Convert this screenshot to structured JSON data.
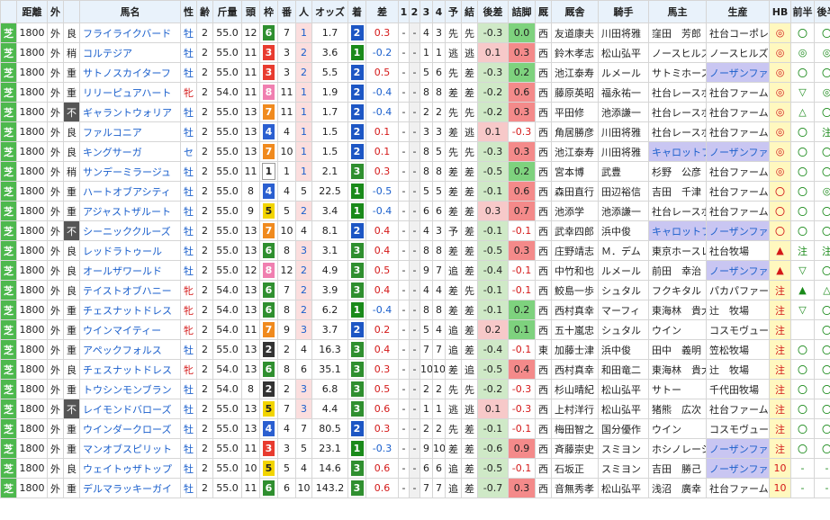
{
  "headers": [
    "",
    "距離",
    "外",
    "",
    "馬名",
    "性",
    "齢",
    "斤量",
    "頭",
    "枠",
    "番",
    "人",
    "オッズ",
    "着",
    "差",
    "1",
    "2",
    "3",
    "4",
    "予",
    "結",
    "後差",
    "詰脚",
    "厩",
    "厩舎",
    "騎手",
    "馬主",
    "生産",
    "HB",
    "前半",
    "後半"
  ],
  "colors": {
    "waku1": "#ffffff",
    "waku2": "#333333",
    "waku3": "#e83b2f",
    "waku4": "#2b5fd0",
    "waku5": "#f2d400",
    "waku6": "#2f8f2f",
    "waku7": "#f08a1e",
    "waku8": "#f07fb0",
    "rank1": "#1a8a1a",
    "rank2": "#1d56c4",
    "rank3": "#2f8f2f"
  },
  "rows": [
    {
      "s": "芝",
      "d": "1800",
      "g": "外",
      "c": "良",
      "name": "フライライクバード",
      "sex": "牡",
      "age": "2",
      "kin": "55.0",
      "n": "12",
      "w": "6",
      "b": "7",
      "pop": "1",
      "odds": "1.7",
      "rank": "2",
      "diff": "0.3",
      "p1": "-",
      "p2": "-",
      "p3": "4",
      "p4": "3",
      "y": "先",
      "r": "先",
      "ato": "-0.3",
      "tsu": "0.0",
      "st": "西",
      "trainer": "友道康夫",
      "jockey": "川田将雅",
      "owner": "窪田　芳郎",
      "breeder": "社台コーポレ",
      "hb": "◎",
      "zen": "〇",
      "kou": "〇"
    },
    {
      "s": "芝",
      "d": "1800",
      "g": "外",
      "c": "稍",
      "name": "コルテジア",
      "sex": "牡",
      "age": "2",
      "kin": "55.0",
      "n": "11",
      "w": "3",
      "b": "3",
      "pop": "2",
      "odds": "3.6",
      "rank": "1",
      "diff": "-0.2",
      "p1": "-",
      "p2": "-",
      "p3": "1",
      "p4": "1",
      "y": "逃",
      "r": "逃",
      "ato": "0.1",
      "tsu": "0.3",
      "st": "西",
      "trainer": "鈴木孝志",
      "jockey": "松山弘平",
      "owner": "ノースヒルズ",
      "breeder": "ノースヒルズ",
      "hb": "◎",
      "zen": "◎",
      "kou": "◎"
    },
    {
      "s": "芝",
      "d": "1800",
      "g": "外",
      "c": "重",
      "name": "サトノスカイターフ",
      "sex": "牡",
      "age": "2",
      "kin": "55.0",
      "n": "11",
      "w": "3",
      "b": "3",
      "pop": "2",
      "odds": "5.5",
      "rank": "2",
      "diff": "0.5",
      "p1": "-",
      "p2": "-",
      "p3": "5",
      "p4": "6",
      "y": "先",
      "r": "差",
      "ato": "-0.3",
      "tsu": "0.2",
      "st": "西",
      "trainer": "池江泰寿",
      "jockey": "ルメール",
      "owner": "サトミホース",
      "breeder": "ノーザンファ",
      "hb": "◎",
      "zen": "〇",
      "kou": "〇"
    },
    {
      "s": "芝",
      "d": "1800",
      "g": "外",
      "c": "重",
      "name": "リリーピュアハート",
      "sex": "牝",
      "age": "2",
      "kin": "54.0",
      "n": "11",
      "w": "8",
      "b": "11",
      "pop": "1",
      "odds": "1.9",
      "rank": "2",
      "diff": "-0.4",
      "p1": "-",
      "p2": "-",
      "p3": "8",
      "p4": "8",
      "y": "差",
      "r": "差",
      "ato": "-0.2",
      "tsu": "0.6",
      "st": "西",
      "trainer": "藤原英昭",
      "jockey": "福永祐一",
      "owner": "社台レースホ",
      "breeder": "社台ファーム",
      "hb": "◎",
      "zen": "▽",
      "kou": "◎"
    },
    {
      "s": "芝",
      "d": "1800",
      "g": "外",
      "c": "不",
      "name": "ギャラントウォリア",
      "sex": "牡",
      "age": "2",
      "kin": "55.0",
      "n": "13",
      "w": "7",
      "b": "11",
      "pop": "1",
      "odds": "1.7",
      "rank": "2",
      "diff": "-0.4",
      "p1": "-",
      "p2": "-",
      "p3": "2",
      "p4": "2",
      "y": "先",
      "r": "先",
      "ato": "-0.2",
      "tsu": "0.3",
      "st": "西",
      "trainer": "平田修",
      "jockey": "池添謙一",
      "owner": "社台レースホ",
      "breeder": "社台ファーム",
      "hb": "◎",
      "zen": "△",
      "kou": "〇"
    },
    {
      "s": "芝",
      "d": "1800",
      "g": "外",
      "c": "良",
      "name": "ファルコニア",
      "sex": "牡",
      "age": "2",
      "kin": "55.0",
      "n": "13",
      "w": "4",
      "b": "4",
      "pop": "1",
      "odds": "1.5",
      "rank": "2",
      "diff": "0.1",
      "p1": "-",
      "p2": "-",
      "p3": "3",
      "p4": "3",
      "y": "差",
      "r": "逃",
      "ato": "0.1",
      "tsu": "-0.3",
      "st": "西",
      "trainer": "角居勝彦",
      "jockey": "川田将雅",
      "owner": "社台レースホ",
      "breeder": "社台ファーム",
      "hb": "◎",
      "zen": "〇",
      "kou": "注"
    },
    {
      "s": "芝",
      "d": "1800",
      "g": "外",
      "c": "良",
      "name": "キングサーガ",
      "sex": "セ",
      "age": "2",
      "kin": "55.0",
      "n": "13",
      "w": "7",
      "b": "10",
      "pop": "1",
      "odds": "1.5",
      "rank": "2",
      "diff": "0.1",
      "p1": "-",
      "p2": "-",
      "p3": "8",
      "p4": "5",
      "y": "先",
      "r": "先",
      "ato": "-0.3",
      "tsu": "0.3",
      "st": "西",
      "trainer": "池江泰寿",
      "jockey": "川田将雅",
      "owner": "キャロットフ",
      "breeder": "ノーザンファ",
      "hb": "◎",
      "zen": "〇",
      "kou": "〇"
    },
    {
      "s": "芝",
      "d": "1800",
      "g": "外",
      "c": "稍",
      "name": "サンデーミラージュ",
      "sex": "牡",
      "age": "2",
      "kin": "55.0",
      "n": "11",
      "w": "1",
      "b": "1",
      "pop": "1",
      "odds": "2.1",
      "rank": "3",
      "diff": "0.3",
      "p1": "-",
      "p2": "-",
      "p3": "8",
      "p4": "8",
      "y": "差",
      "r": "差",
      "ato": "-0.5",
      "tsu": "0.2",
      "st": "西",
      "trainer": "宮本博",
      "jockey": "武豊",
      "owner": "杉野　公彦",
      "breeder": "社台ファーム",
      "hb": "◎",
      "zen": "〇",
      "kou": "〇"
    },
    {
      "s": "芝",
      "d": "1800",
      "g": "外",
      "c": "重",
      "name": "ハートオブアシティ",
      "sex": "牡",
      "age": "2",
      "kin": "55.0",
      "n": "8",
      "w": "4",
      "b": "4",
      "pop": "5",
      "odds": "22.5",
      "rank": "1",
      "diff": "-0.5",
      "p1": "-",
      "p2": "-",
      "p3": "5",
      "p4": "5",
      "y": "差",
      "r": "差",
      "ato": "-0.1",
      "tsu": "0.6",
      "st": "西",
      "trainer": "森田直行",
      "jockey": "田辺裕信",
      "owner": "吉田　千津",
      "breeder": "社台ファーム",
      "hb": "〇",
      "zen": "〇",
      "kou": "◎"
    },
    {
      "s": "芝",
      "d": "1800",
      "g": "外",
      "c": "重",
      "name": "アジャストザルート",
      "sex": "牡",
      "age": "2",
      "kin": "55.0",
      "n": "9",
      "w": "5",
      "b": "5",
      "pop": "2",
      "odds": "3.4",
      "rank": "1",
      "diff": "-0.4",
      "p1": "-",
      "p2": "-",
      "p3": "6",
      "p4": "6",
      "y": "差",
      "r": "差",
      "ato": "0.3",
      "tsu": "0.7",
      "st": "西",
      "trainer": "池添学",
      "jockey": "池添謙一",
      "owner": "社台レースホ",
      "breeder": "社台ファーム",
      "hb": "〇",
      "zen": "〇",
      "kou": "〇"
    },
    {
      "s": "芝",
      "d": "1800",
      "g": "外",
      "c": "不",
      "name": "シーニッククルーズ",
      "sex": "牡",
      "age": "2",
      "kin": "55.0",
      "n": "13",
      "w": "7",
      "b": "10",
      "pop": "4",
      "odds": "8.1",
      "rank": "2",
      "diff": "0.4",
      "p1": "-",
      "p2": "-",
      "p3": "4",
      "p4": "3",
      "y": "予",
      "r": "差",
      "ato": "-0.1",
      "tsu": "-0.1",
      "st": "西",
      "trainer": "武幸四郎",
      "jockey": "浜中俊",
      "owner": "キャロットフ",
      "breeder": "ノーザンファ",
      "hb": "〇",
      "zen": "〇",
      "kou": "〇"
    },
    {
      "s": "芝",
      "d": "1800",
      "g": "外",
      "c": "良",
      "name": "レッドラトゥール",
      "sex": "牡",
      "age": "2",
      "kin": "55.0",
      "n": "13",
      "w": "6",
      "b": "8",
      "pop": "3",
      "odds": "3.1",
      "rank": "3",
      "diff": "0.4",
      "p1": "-",
      "p2": "-",
      "p3": "8",
      "p4": "8",
      "y": "差",
      "r": "差",
      "ato": "-0.5",
      "tsu": "0.3",
      "st": "西",
      "trainer": "庄野靖志",
      "jockey": "Ｍ．デム",
      "owner": "東京ホースレ",
      "breeder": "社台牧場",
      "hb": "▲",
      "zen": "注",
      "kou": "注"
    },
    {
      "s": "芝",
      "d": "1800",
      "g": "外",
      "c": "良",
      "name": "オールザワールド",
      "sex": "牡",
      "age": "2",
      "kin": "55.0",
      "n": "12",
      "w": "8",
      "b": "12",
      "pop": "2",
      "odds": "4.9",
      "rank": "3",
      "diff": "0.5",
      "p1": "-",
      "p2": "-",
      "p3": "9",
      "p4": "7",
      "y": "追",
      "r": "差",
      "ato": "-0.4",
      "tsu": "-0.1",
      "st": "西",
      "trainer": "中竹和也",
      "jockey": "ルメール",
      "owner": "前田　幸治",
      "breeder": "ノーザンファ",
      "hb": "▲",
      "zen": "▽",
      "kou": "〇"
    },
    {
      "s": "芝",
      "d": "1800",
      "g": "外",
      "c": "良",
      "name": "テイストオブハニー",
      "sex": "牝",
      "age": "2",
      "kin": "54.0",
      "n": "13",
      "w": "6",
      "b": "7",
      "pop": "2",
      "odds": "3.9",
      "rank": "3",
      "diff": "0.4",
      "p1": "-",
      "p2": "-",
      "p3": "4",
      "p4": "4",
      "y": "差",
      "r": "先",
      "ato": "-0.1",
      "tsu": "-0.1",
      "st": "西",
      "trainer": "鮫島一歩",
      "jockey": "シュタル",
      "owner": "フクキタル",
      "breeder": "パカパファーム",
      "hb": "注",
      "zen": "▲",
      "kou": "△"
    },
    {
      "s": "芝",
      "d": "1800",
      "g": "外",
      "c": "重",
      "name": "チェスナットドレス",
      "sex": "牝",
      "age": "2",
      "kin": "54.0",
      "n": "13",
      "w": "6",
      "b": "8",
      "pop": "2",
      "odds": "6.2",
      "rank": "1",
      "diff": "-0.4",
      "p1": "-",
      "p2": "-",
      "p3": "8",
      "p4": "8",
      "y": "差",
      "r": "差",
      "ato": "-0.1",
      "tsu": "0.2",
      "st": "西",
      "trainer": "西村真幸",
      "jockey": "マーフィ",
      "owner": "東海林　貴大",
      "breeder": "辻　牧場",
      "hb": "注",
      "zen": "▽",
      "kou": "〇"
    },
    {
      "s": "芝",
      "d": "1800",
      "g": "外",
      "c": "重",
      "name": "ウインマイティー",
      "sex": "牝",
      "age": "2",
      "kin": "54.0",
      "n": "11",
      "w": "7",
      "b": "9",
      "pop": "3",
      "odds": "3.7",
      "rank": "2",
      "diff": "0.2",
      "p1": "-",
      "p2": "-",
      "p3": "5",
      "p4": "4",
      "y": "追",
      "r": "差",
      "ato": "0.2",
      "tsu": "0.1",
      "st": "西",
      "trainer": "五十嵐忠",
      "jockey": "シュタル",
      "owner": "ウイン",
      "breeder": "コスモヴュー",
      "hb": "注",
      "zen": "",
      "kou": "〇"
    },
    {
      "s": "芝",
      "d": "1800",
      "g": "外",
      "c": "重",
      "name": "アペックフォルス",
      "sex": "牡",
      "age": "2",
      "kin": "55.0",
      "n": "13",
      "w": "2",
      "b": "2",
      "pop": "4",
      "odds": "16.3",
      "rank": "3",
      "diff": "0.4",
      "p1": "-",
      "p2": "-",
      "p3": "7",
      "p4": "7",
      "y": "追",
      "r": "差",
      "ato": "-0.4",
      "tsu": "-0.1",
      "st": "東",
      "trainer": "加藤士津",
      "jockey": "浜中俊",
      "owner": "田中　義明",
      "breeder": "笠松牧場",
      "hb": "注",
      "zen": "〇",
      "kou": "〇"
    },
    {
      "s": "芝",
      "d": "1800",
      "g": "外",
      "c": "良",
      "name": "チェスナットドレス",
      "sex": "牝",
      "age": "2",
      "kin": "54.0",
      "n": "13",
      "w": "6",
      "b": "8",
      "pop": "6",
      "odds": "35.1",
      "rank": "3",
      "diff": "0.3",
      "p1": "-",
      "p2": "-",
      "p3": "10",
      "p4": "10",
      "y": "差",
      "r": "追",
      "ato": "-0.5",
      "tsu": "0.4",
      "st": "西",
      "trainer": "西村真幸",
      "jockey": "和田竜二",
      "owner": "東海林　貴大",
      "breeder": "辻　牧場",
      "hb": "注",
      "zen": "〇",
      "kou": "〇"
    },
    {
      "s": "芝",
      "d": "1800",
      "g": "外",
      "c": "重",
      "name": "トウシンモンブラン",
      "sex": "牡",
      "age": "2",
      "kin": "54.0",
      "n": "8",
      "w": "2",
      "b": "2",
      "pop": "3",
      "odds": "6.8",
      "rank": "3",
      "diff": "0.5",
      "p1": "-",
      "p2": "-",
      "p3": "2",
      "p4": "2",
      "y": "先",
      "r": "先",
      "ato": "-0.2",
      "tsu": "-0.3",
      "st": "西",
      "trainer": "杉山晴紀",
      "jockey": "松山弘平",
      "owner": "サトー",
      "breeder": "千代田牧場",
      "hb": "注",
      "zen": "〇",
      "kou": "〇"
    },
    {
      "s": "芝",
      "d": "1800",
      "g": "外",
      "c": "不",
      "name": "レイモンドバローズ",
      "sex": "牡",
      "age": "2",
      "kin": "55.0",
      "n": "13",
      "w": "5",
      "b": "7",
      "pop": "3",
      "odds": "4.4",
      "rank": "3",
      "diff": "0.6",
      "p1": "-",
      "p2": "-",
      "p3": "1",
      "p4": "1",
      "y": "逃",
      "r": "逃",
      "ato": "0.1",
      "tsu": "-0.3",
      "st": "西",
      "trainer": "上村洋行",
      "jockey": "松山弘平",
      "owner": "猪熊　広次",
      "breeder": "社台ファーム",
      "hb": "注",
      "zen": "〇",
      "kou": "〇"
    },
    {
      "s": "芝",
      "d": "1800",
      "g": "外",
      "c": "重",
      "name": "ウインダークローズ",
      "sex": "牡",
      "age": "2",
      "kin": "55.0",
      "n": "13",
      "w": "4",
      "b": "4",
      "pop": "7",
      "odds": "80.5",
      "rank": "2",
      "diff": "0.3",
      "p1": "-",
      "p2": "-",
      "p3": "2",
      "p4": "2",
      "y": "先",
      "r": "差",
      "ato": "-0.1",
      "tsu": "-0.1",
      "st": "西",
      "trainer": "梅田智之",
      "jockey": "国分優作",
      "owner": "ウイン",
      "breeder": "コスモヴュー",
      "hb": "注",
      "zen": "〇",
      "kou": "〇"
    },
    {
      "s": "芝",
      "d": "1800",
      "g": "外",
      "c": "重",
      "name": "マンオブスピリット",
      "sex": "牡",
      "age": "2",
      "kin": "55.0",
      "n": "11",
      "w": "3",
      "b": "3",
      "pop": "5",
      "odds": "23.1",
      "rank": "1",
      "diff": "-0.3",
      "p1": "-",
      "p2": "-",
      "p3": "9",
      "p4": "10",
      "y": "差",
      "r": "差",
      "ato": "-0.6",
      "tsu": "0.9",
      "st": "西",
      "trainer": "斉藤崇史",
      "jockey": "スミヨン",
      "owner": "ホシノレーシ",
      "breeder": "ノーザンファ",
      "hb": "注",
      "zen": "〇",
      "kou": "〇"
    },
    {
      "s": "芝",
      "d": "1800",
      "g": "外",
      "c": "良",
      "name": "ウェイトゥザトップ",
      "sex": "牡",
      "age": "2",
      "kin": "55.0",
      "n": "10",
      "w": "5",
      "b": "5",
      "pop": "4",
      "odds": "14.6",
      "rank": "3",
      "diff": "0.6",
      "p1": "-",
      "p2": "-",
      "p3": "6",
      "p4": "6",
      "y": "追",
      "r": "差",
      "ato": "-0.5",
      "tsu": "-0.1",
      "st": "西",
      "trainer": "石坂正",
      "jockey": "スミヨン",
      "owner": "吉田　勝己",
      "breeder": "ノーザンファ",
      "hb": "10",
      "zen": "-",
      "kou": "-"
    },
    {
      "s": "芝",
      "d": "1800",
      "g": "外",
      "c": "重",
      "name": "デルマラッキーガイ",
      "sex": "牡",
      "age": "2",
      "kin": "55.0",
      "n": "11",
      "w": "6",
      "b": "6",
      "pop": "10",
      "odds": "143.2",
      "rank": "3",
      "diff": "0.6",
      "p1": "-",
      "p2": "-",
      "p3": "7",
      "p4": "7",
      "y": "追",
      "r": "差",
      "ato": "-0.7",
      "tsu": "0.3",
      "st": "西",
      "trainer": "音無秀孝",
      "jockey": "松山弘平",
      "owner": "浅沼　廣幸",
      "breeder": "社台ファーム",
      "hb": "10",
      "zen": "-",
      "kou": "-"
    }
  ]
}
